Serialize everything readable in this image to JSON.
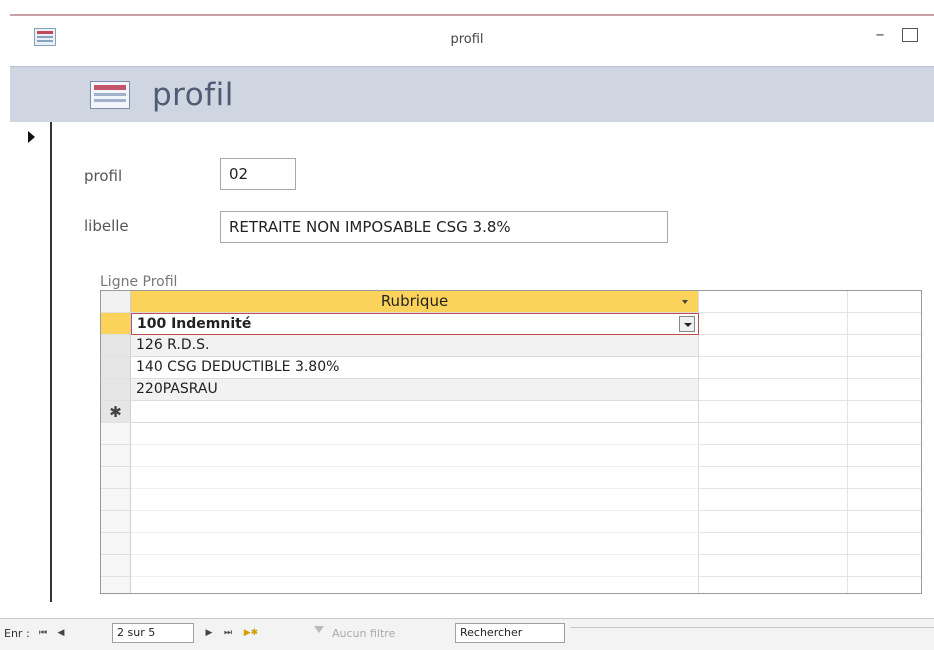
{
  "window": {
    "title": "profil"
  },
  "form": {
    "title": "profil",
    "fields": {
      "profil": {
        "label": "profil",
        "value": "02"
      },
      "libelle": {
        "label": "libelle",
        "value": "RETRAITE NON IMPOSABLE CSG 3.8%"
      }
    }
  },
  "subform": {
    "label": "Ligne Profil",
    "column_header": "Rubrique",
    "rows": [
      "100 Indemnité",
      "126 R.D.S.",
      "140 CSG DEDUCTIBLE 3.80%",
      "220PASRAU"
    ],
    "new_row_marker": "✱"
  },
  "navigation": {
    "label": "Enr :",
    "first": "⏮",
    "prev": "◀",
    "record": "2 sur 5",
    "next": "▶",
    "last": "⏭",
    "new": "▶✱",
    "filter": "Aucun filtre",
    "search": "Rechercher"
  }
}
